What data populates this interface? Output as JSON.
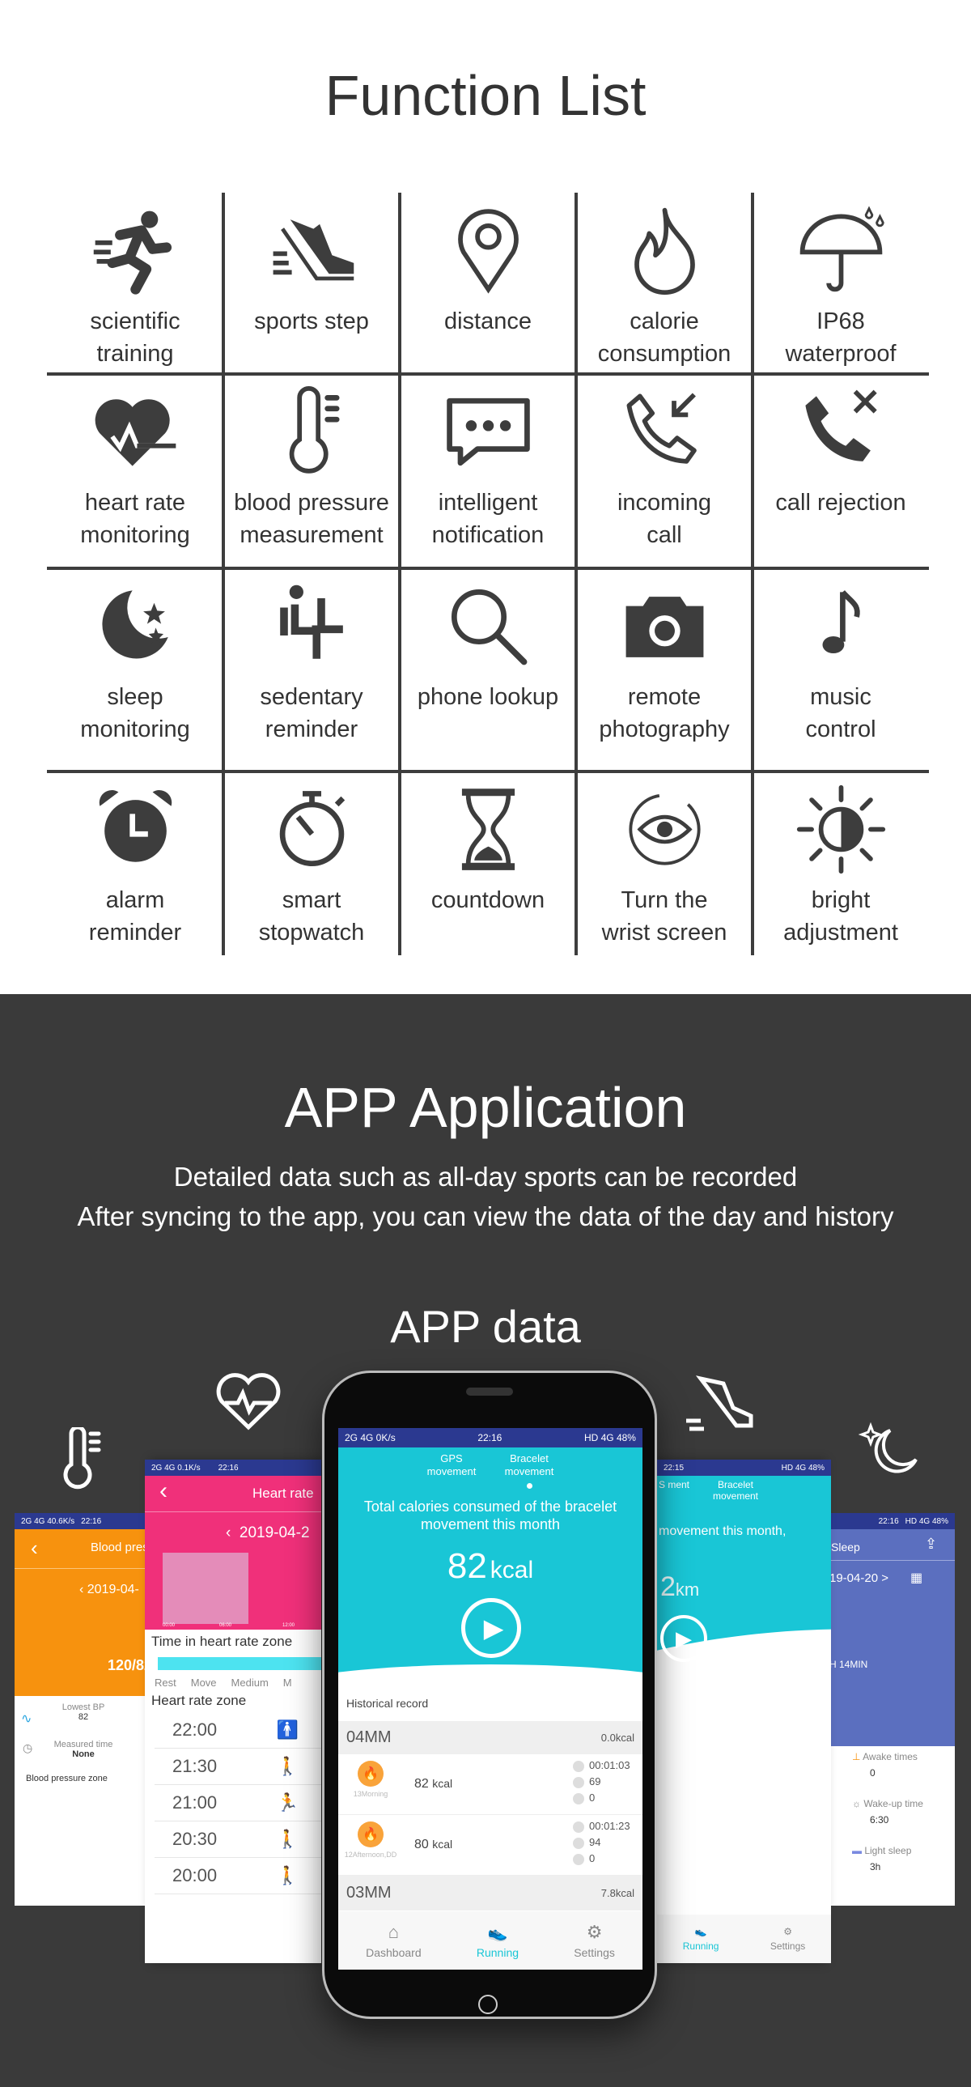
{
  "function_list": {
    "title": "Function List",
    "items": [
      {
        "icon": "running-person-icon",
        "lines": [
          "scientific",
          "training"
        ]
      },
      {
        "icon": "sneaker-icon",
        "lines": [
          "sports step"
        ]
      },
      {
        "icon": "location-pin-icon",
        "lines": [
          "distance"
        ]
      },
      {
        "icon": "flame-icon",
        "lines": [
          "calorie",
          "consumption"
        ]
      },
      {
        "icon": "umbrella-icon",
        "lines": [
          "IP68",
          "waterproof"
        ]
      },
      {
        "icon": "heart-pulse-icon",
        "lines": [
          "heart rate",
          "monitoring"
        ]
      },
      {
        "icon": "thermometer-icon",
        "lines": [
          "blood pressure",
          "measurement"
        ]
      },
      {
        "icon": "chat-bubble-icon",
        "lines": [
          "intelligent",
          "notification"
        ]
      },
      {
        "icon": "incoming-call-icon",
        "lines": [
          "incoming",
          "call"
        ]
      },
      {
        "icon": "call-reject-icon",
        "lines": [
          "call rejection"
        ]
      },
      {
        "icon": "moon-stars-icon",
        "lines": [
          "sleep",
          "monitoring"
        ]
      },
      {
        "icon": "sedentary-icon",
        "lines": [
          "sedentary",
          "reminder"
        ]
      },
      {
        "icon": "magnifier-icon",
        "lines": [
          "phone lookup"
        ]
      },
      {
        "icon": "camera-icon",
        "lines": [
          "remote",
          "photography"
        ]
      },
      {
        "icon": "music-note-icon",
        "lines": [
          "music",
          "control"
        ]
      },
      {
        "icon": "alarm-clock-icon",
        "lines": [
          "alarm",
          "reminder"
        ]
      },
      {
        "icon": "stopwatch-icon",
        "lines": [
          "smart",
          "stopwatch"
        ]
      },
      {
        "icon": "hourglass-icon",
        "lines": [
          "countdown"
        ]
      },
      {
        "icon": "eye-rotate-icon",
        "lines": [
          "Turn the",
          "wrist screen"
        ]
      },
      {
        "icon": "brightness-icon",
        "lines": [
          "bright",
          "adjustment"
        ]
      }
    ]
  },
  "app": {
    "title": "APP Application",
    "subtitle_1": "Detailed data such as all-day sports can be recorded",
    "subtitle_2": "After syncing to the app, you can view the data of the day and history",
    "data_title": "APP data"
  },
  "center_phone": {
    "status_left": "2G 4G 0K/s",
    "status_time": "22:16",
    "status_right": "HD 4G 48%",
    "tab_gps": "GPS movement",
    "tab_bracelet": "Bracelet movement",
    "headline": "Total calories consumed of the bracelet movement this month",
    "value": "82",
    "unit": "kcal",
    "history_label": "Historical record",
    "months": [
      {
        "label": "04MM",
        "total": "0.0kcal"
      },
      {
        "label": "03MM",
        "total": "7.8kcal"
      }
    ],
    "entries": [
      {
        "kcal": "82",
        "unit": "kcal",
        "time_label": "13Morning",
        "duration": "00:01:03",
        "heart": "69",
        "steps": "0"
      },
      {
        "kcal": "80",
        "unit": "kcal",
        "time_label": "12Afternoon,DD",
        "duration": "00:01:23",
        "heart": "94",
        "steps": "0"
      }
    ],
    "nav": [
      "Dashboard",
      "Running",
      "Settings"
    ]
  },
  "heart_phone": {
    "status_left": "2G 4G 0.1K/s",
    "status_time": "22:16",
    "title": "Heart rate",
    "date": "2019-04-2",
    "ticks": [
      "00:00",
      "06:00",
      "12:00"
    ],
    "zone_title": "Time in heart rate zone",
    "zones": [
      "Rest",
      "Move",
      "Medium",
      "M"
    ],
    "list_title": "Heart rate zone",
    "times": [
      "22:00",
      "21:30",
      "21:00",
      "20:30",
      "20:00"
    ]
  },
  "bp_phone": {
    "status_left": "2G 4G 40.6K/s",
    "status_time": "22:16",
    "title": "Blood press",
    "date": "2019-04-",
    "reading": "120/82",
    "lowest_label": "Lowest BP",
    "lowest_value": "82",
    "measured_label": "Measured time",
    "measured_value": "None",
    "zone_label": "Blood pressure zone"
  },
  "distance_phone": {
    "status_time": "22:15",
    "status_right": "HD 4G 48%",
    "tab_gps": "S ment",
    "tab_bracelet": "Bracelet movement",
    "headline": "movement this month,",
    "value": "2",
    "unit": "km",
    "nav": [
      "Running",
      "Settings"
    ]
  },
  "sleep_phone": {
    "status_time": "22:16",
    "status_right": "HD 4G 48%",
    "title": "Sleep",
    "date": "19-04-20 >",
    "duration": "H 14MIN",
    "stats": [
      {
        "label": "Awake times",
        "value": "0"
      },
      {
        "label": "Wake-up time",
        "value": "6:30"
      },
      {
        "label": "Light sleep",
        "value": "3h"
      }
    ]
  },
  "colors": {
    "teal": "#19c6d6",
    "pink": "#f0307a",
    "orange": "#f7920e",
    "sleep_blue": "#5b6fbf",
    "status_blue": "#2b3990",
    "dark_bg": "#3a3a3a",
    "icon_gray": "#3d3d3d"
  }
}
